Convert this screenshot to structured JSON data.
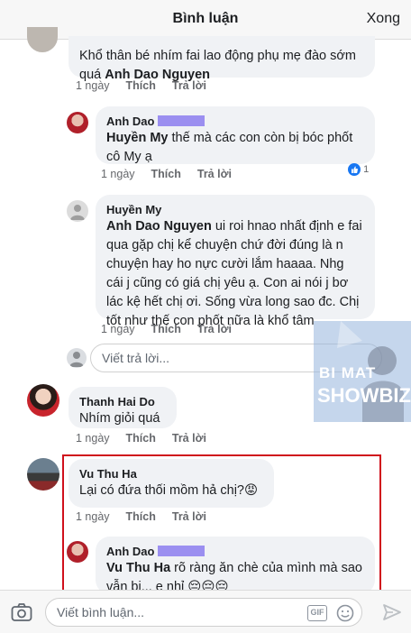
{
  "header": {
    "title": "Bình luận",
    "done_label": "Xong"
  },
  "comments": {
    "top": {
      "text": "Khổ thân bé nhím fai lao động phụ mẹ đào sớm quá",
      "mention": "Anh Dao Nguyen",
      "time": "1 ngày",
      "like": "Thích",
      "reply": "Trả lời"
    },
    "reply1": {
      "author": "Anh Dao",
      "mention": "Huyền My",
      "text": " thế mà các con còn bị bóc phốt cô My ạ",
      "time": "1 ngày",
      "like": "Thích",
      "reply": "Trả lời",
      "reaction_count": "1"
    },
    "reply2": {
      "author": "Huyền My",
      "mention": "Anh Dao Nguyen",
      "text": "  ui roi hnao nhất định e fai qua gặp chị kể chuyện chứ đời đúng là n chuyện hay ho nực cười lắm haaaa. Nhg cái j cũng có giá chị yêu ạ. Con ai nói j bơ lác kệ hết chị ơi. Sống vừa long sao đc. Chị tốt như thế con phốt nữa là khổ tâm",
      "time": "1 ngày",
      "like": "Thích",
      "reply": "Trả lời"
    },
    "reply_placeholder": "Viết trả lời...",
    "thanh": {
      "author": "Thanh Hai Do",
      "text": "Nhím giỏi quá",
      "time": "1 ngày",
      "like": "Thích",
      "reply": "Trả lời"
    },
    "vu": {
      "author": "Vu Thu Ha",
      "text": "Lại có đứa thối mồm hả chị?😡",
      "time": "1 ngày",
      "like": "Thích",
      "reply": "Trả lời"
    },
    "reply3": {
      "author": "Anh Dao",
      "mention": "Vu Thu Ha",
      "text": " rõ ràng ăn chè của mình mà sao vẫn bị... e nhỉ 😔😔😔"
    }
  },
  "watermark": {
    "line1": "BI MAT",
    "line2": "SHOWBIZ"
  },
  "footer": {
    "placeholder": "Viết bình luận...",
    "gif_label": "GIF"
  },
  "colors": {
    "accent": "#1877f2",
    "highlight_frame": "#d0101c",
    "redaction": "#9b8ff0"
  }
}
